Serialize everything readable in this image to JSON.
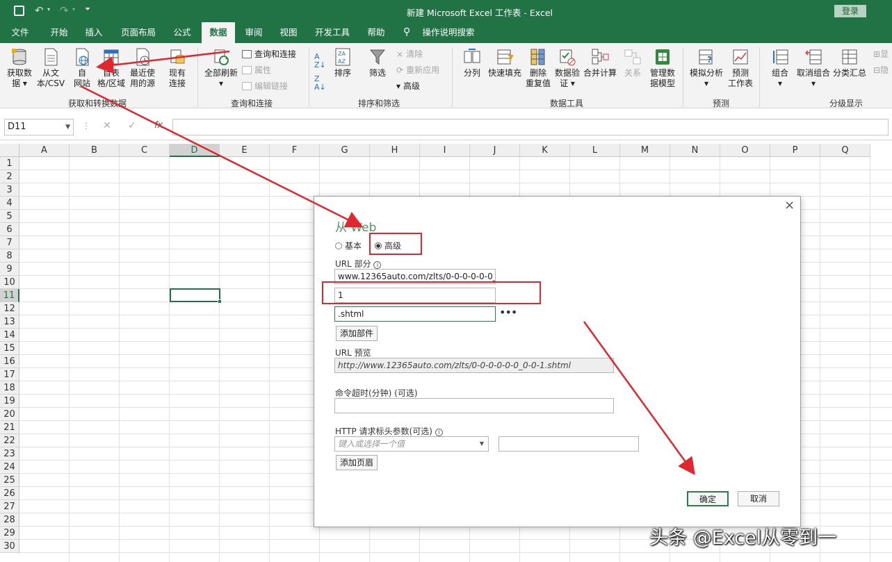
{
  "titlebar": {
    "title": "新建 Microsoft Excel 工作表  -  Excel",
    "login": "登录"
  },
  "tabs": [
    "文件",
    "开始",
    "插入",
    "页面布局",
    "公式",
    "数据",
    "审阅",
    "视图",
    "开发工具",
    "帮助",
    "操作说明搜索"
  ],
  "active_tab": "数据",
  "ribbon": {
    "get_data": {
      "btn1": "获取数",
      "btn1b": "据",
      "btn2": "从文",
      "btn2b": "本/CSV",
      "btn3": "自",
      "btn3b": "网站",
      "btn4": "自表",
      "btn4b": "格/区域",
      "btn5": "最近使",
      "btn5b": "用的源",
      "btn6": "现有",
      "btn6b": "连接",
      "label": "获取和转换数据"
    },
    "queries": {
      "refresh": "全部刷新",
      "item1": "查询和连接",
      "item2": "属性",
      "item3": "编辑链接",
      "label": "查询和连接"
    },
    "sort": {
      "sort": "排序",
      "filter": "筛选",
      "clear": "清除",
      "reapply": "重新应用",
      "advanced": "高级",
      "label": "排序和筛选"
    },
    "tools": {
      "split": "分列",
      "flash": "快速填充",
      "dup1": "删除",
      "dup2": "重复值",
      "valid1": "数据验",
      "valid2": "证",
      "consol": "合并计算",
      "rel": "关系",
      "model1": "管理数",
      "model2": "据模型",
      "label": "数据工具"
    },
    "forecast": {
      "whatif": "模拟分析",
      "sheet1": "预测",
      "sheet2": "工作表",
      "label": "预测"
    },
    "outline": {
      "group": "组合",
      "ungroup": "取消组合",
      "subtotal": "分类汇总",
      "show": "显",
      "hide": "隐",
      "label": "分级显示"
    }
  },
  "formula_bar": {
    "name_box": "D11",
    "fx": "fx"
  },
  "columns": [
    "A",
    "B",
    "C",
    "D",
    "E",
    "F",
    "G",
    "H",
    "I",
    "J",
    "K",
    "L",
    "M",
    "N",
    "O",
    "P",
    "Q"
  ],
  "rows": [
    "1",
    "2",
    "3",
    "4",
    "5",
    "6",
    "7",
    "8",
    "9",
    "10",
    "11",
    "12",
    "13",
    "14",
    "15",
    "16",
    "17",
    "18",
    "19",
    "20",
    "21",
    "22",
    "23",
    "24",
    "25",
    "26",
    "27",
    "28",
    "29",
    "30"
  ],
  "dialog": {
    "title": "从 Web",
    "radio_basic": "基本",
    "radio_advanced": "高级",
    "url_parts_label": "URL 部分",
    "url_part1": "www.12365auto.com/zlts/0-0-0-0-0-0_0-0-",
    "url_part2": "1",
    "url_part3": ".shtml",
    "add_part": "添加部件",
    "url_preview_label": "URL 预览",
    "url_preview": "http://www.12365auto.com/zlts/0-0-0-0-0-0_0-0-1.shtml",
    "timeout_label": "命令超时(分钟) (可选)",
    "http_label": "HTTP 请求标头参数(可选)",
    "header_placeholder": "键入或选择一个值",
    "add_header": "添加页眉",
    "ok": "确定",
    "cancel": "取消"
  },
  "watermark": "头条 @Excel从零到一",
  "colors": {
    "excel_green": "#217346",
    "annotation_red": "#e0262e"
  }
}
